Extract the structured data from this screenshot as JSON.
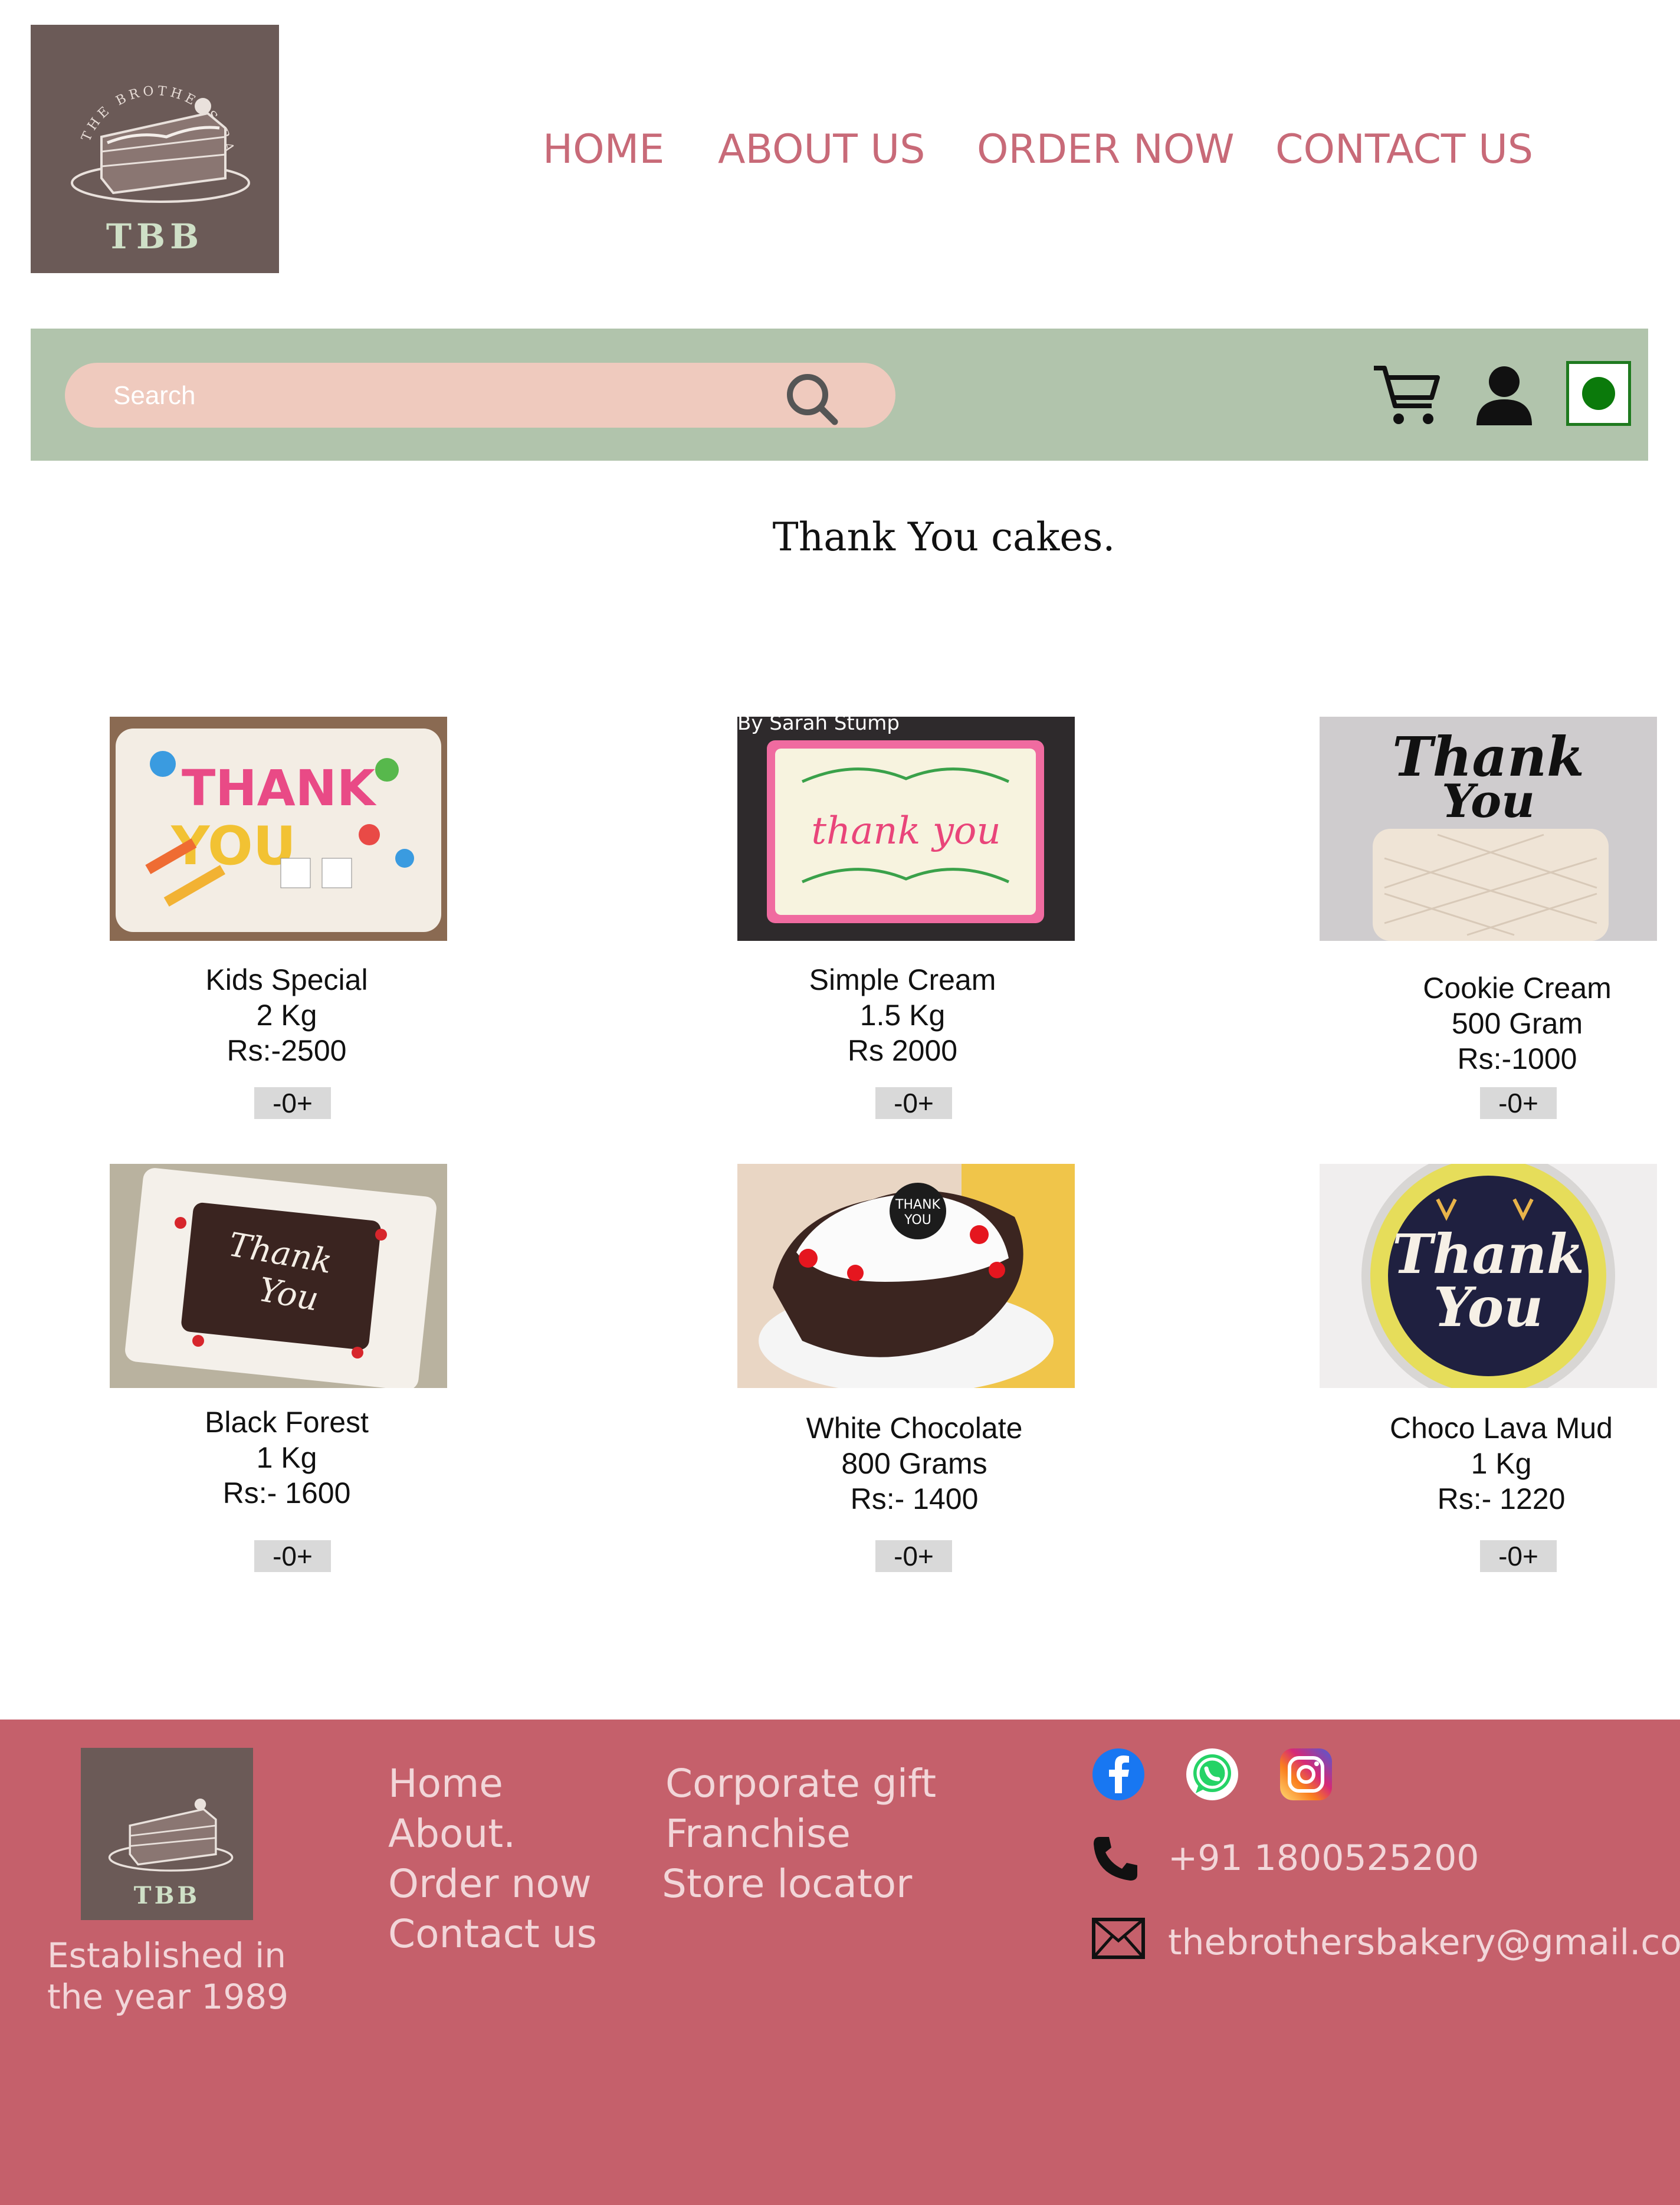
{
  "header": {
    "logo_text": "TBB",
    "logo_arc_text": "THE BROTHERS BAKERY",
    "nav": [
      {
        "label": "HOME"
      },
      {
        "label": "ABOUT US"
      },
      {
        "label": "ORDER NOW"
      },
      {
        "label": "CONTACT US"
      }
    ]
  },
  "search": {
    "placeholder": "Search",
    "icons": [
      "search-icon",
      "cart-icon",
      "user-icon",
      "veg-indicator-icon"
    ]
  },
  "page_title": "Thank You cakes.",
  "products": [
    {
      "name": "Kids Special",
      "weight": "2 Kg",
      "price": "Rs:-2500",
      "qty": "-0+",
      "image": "kids-thank-you-cake"
    },
    {
      "name": "Simple Cream",
      "weight": "1.5 Kg",
      "price": "Rs 2000",
      "qty": "-0+",
      "image": "cream-thank-you-cake",
      "image_caption": "By Sarah Stump"
    },
    {
      "name": "Cookie Cream",
      "weight": "500 Gram",
      "price": "Rs:-1000",
      "qty": "-0+",
      "image": "cookie-cream-cake",
      "image_topper": "Thank You"
    },
    {
      "name": "Black Forest",
      "weight": "1 Kg",
      "price": "Rs:- 1600",
      "qty": "-0+",
      "image": "black-forest-cake",
      "image_text": "Thank You"
    },
    {
      "name": "White Chocolate",
      "weight": "800 Grams",
      "price": "Rs:- 1400",
      "qty": "-0+",
      "image": "white-chocolate-cake",
      "image_text": "THANK YOU"
    },
    {
      "name": "Choco Lava Mud",
      "weight": "1 Kg",
      "price": "Rs:- 1220",
      "qty": "-0+",
      "image": "choco-lava-cake",
      "image_text": "Thank You"
    }
  ],
  "footer": {
    "logo_text": "TBB",
    "established": [
      "Established in",
      "the year 1989"
    ],
    "links_col1": [
      "Home",
      "About.",
      "Order now",
      "Contact us"
    ],
    "links_col2": [
      "Corporate gift",
      "Franchise",
      "Store locator"
    ],
    "social": [
      "facebook-icon",
      "whatsapp-icon",
      "instagram-icon"
    ],
    "phone": "+91 1800525200",
    "email": "thebrothersbakery@gmail.com"
  },
  "colors": {
    "nav_text": "#c86a78",
    "search_bar": "#b1c4ac",
    "search_field": "#efcabe",
    "footer_bg": "#c5606b",
    "logo_bg": "#6b5a57"
  }
}
